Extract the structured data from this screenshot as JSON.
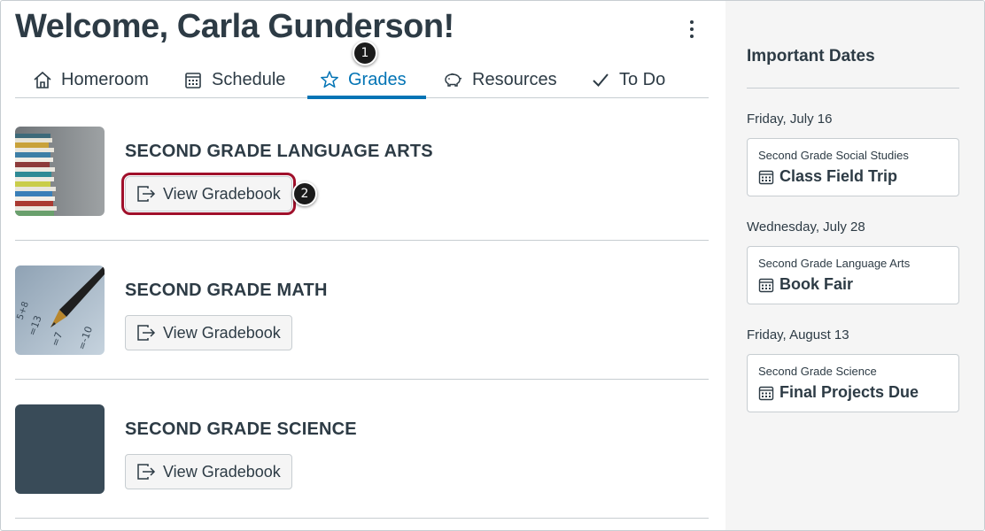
{
  "header": {
    "welcome": "Welcome, Carla Gunderson!"
  },
  "tabs": [
    {
      "label": "Homeroom",
      "icon": "home-icon"
    },
    {
      "label": "Schedule",
      "icon": "calendar-icon"
    },
    {
      "label": "Grades",
      "icon": "star-icon",
      "active": true
    },
    {
      "label": "Resources",
      "icon": "piggy-bank-icon"
    },
    {
      "label": "To Do",
      "icon": "checkmark-icon"
    }
  ],
  "callouts": [
    "1",
    "2"
  ],
  "courses": [
    {
      "title": "SECOND GRADE LANGUAGE ARTS",
      "button": "View Gradebook"
    },
    {
      "title": "SECOND GRADE MATH",
      "button": "View Gradebook"
    },
    {
      "title": "SECOND GRADE SCIENCE",
      "button": "View Gradebook"
    }
  ],
  "sidebar": {
    "title": "Important Dates",
    "groups": [
      {
        "date": "Friday, July 16",
        "course": "Second Grade Social Studies",
        "event": "Class Field Trip"
      },
      {
        "date": "Wednesday, July 28",
        "course": "Second Grade Language Arts",
        "event": "Book Fair"
      },
      {
        "date": "Friday, August 13",
        "course": "Second Grade Science",
        "event": "Final Projects Due"
      }
    ]
  },
  "colors": {
    "accent": "#0374b5",
    "text": "#2d3b45",
    "highlight": "#a0102b",
    "science_tile": "#394b58"
  }
}
